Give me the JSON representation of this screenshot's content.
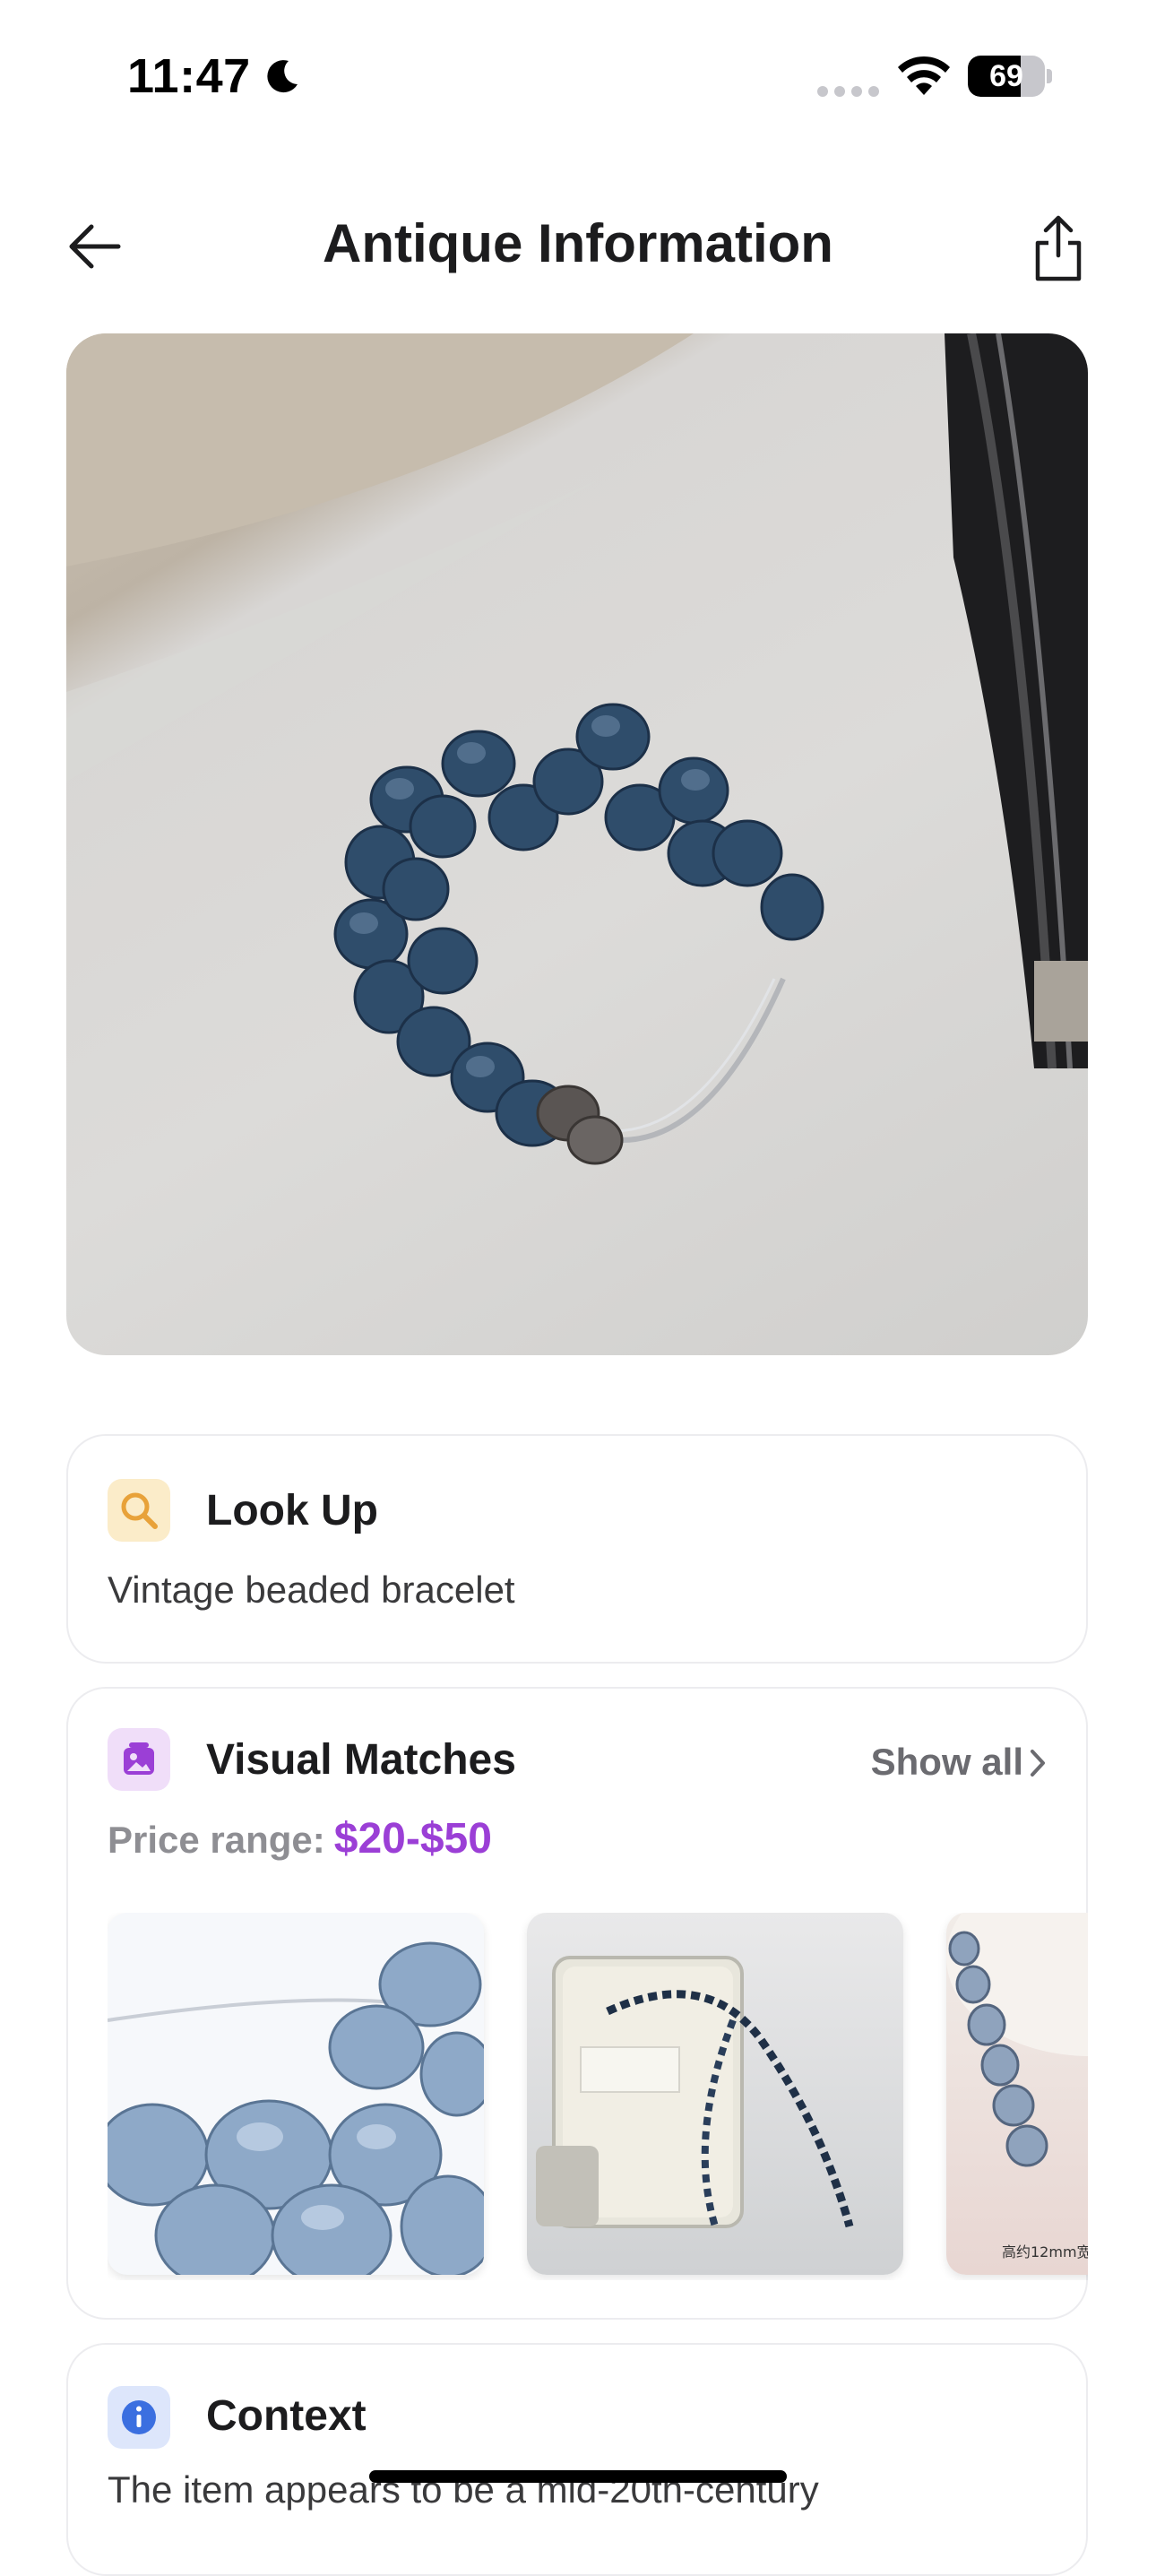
{
  "status_bar": {
    "time": "11:47",
    "battery_level": "69",
    "icons": [
      "moon-icon",
      "cellular-dots-icon",
      "wifi-icon",
      "battery-icon"
    ]
  },
  "nav": {
    "title": "Antique Information",
    "back_icon": "arrow-left-icon",
    "share_icon": "share-icon"
  },
  "hero_image": {
    "subject": "beaded-bracelet-photo"
  },
  "lookup": {
    "title": "Look Up",
    "value": "Vintage beaded bracelet",
    "icon": "search-icon",
    "icon_color": "#e8a23a"
  },
  "visual_matches": {
    "title": "Visual Matches",
    "icon": "image-gallery-icon",
    "icon_color": "#9b3fd6",
    "show_all_label": "Show all",
    "price_label": "Price range:",
    "price_value": "$20-$50",
    "price_color": "#9b3fd6",
    "thumbs": [
      {
        "name": "match-thumb-crystal-beads"
      },
      {
        "name": "match-thumb-perfume-bottle-bracelet"
      },
      {
        "name": "match-thumb-bead-strand",
        "caption": "高约12mm宽"
      }
    ]
  },
  "context": {
    "title": "Context",
    "icon": "info-icon",
    "icon_color": "#3b6fe0",
    "text": "The item appears to be a mid-20th-century"
  }
}
